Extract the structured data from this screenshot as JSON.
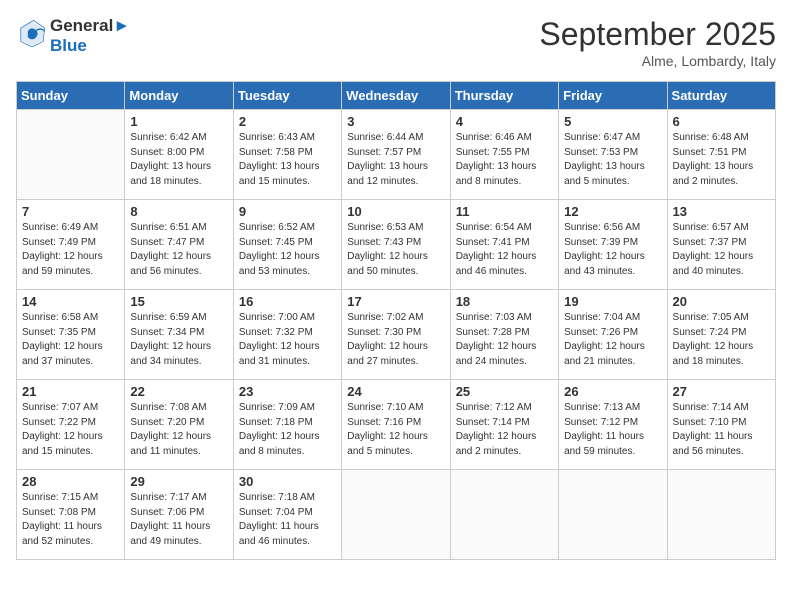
{
  "header": {
    "logo_line1": "General",
    "logo_line2": "Blue",
    "month_title": "September 2025",
    "location": "Alme, Lombardy, Italy"
  },
  "days_of_week": [
    "Sunday",
    "Monday",
    "Tuesday",
    "Wednesday",
    "Thursday",
    "Friday",
    "Saturday"
  ],
  "weeks": [
    [
      {
        "day": "",
        "info": ""
      },
      {
        "day": "1",
        "info": "Sunrise: 6:42 AM\nSunset: 8:00 PM\nDaylight: 13 hours\nand 18 minutes."
      },
      {
        "day": "2",
        "info": "Sunrise: 6:43 AM\nSunset: 7:58 PM\nDaylight: 13 hours\nand 15 minutes."
      },
      {
        "day": "3",
        "info": "Sunrise: 6:44 AM\nSunset: 7:57 PM\nDaylight: 13 hours\nand 12 minutes."
      },
      {
        "day": "4",
        "info": "Sunrise: 6:46 AM\nSunset: 7:55 PM\nDaylight: 13 hours\nand 8 minutes."
      },
      {
        "day": "5",
        "info": "Sunrise: 6:47 AM\nSunset: 7:53 PM\nDaylight: 13 hours\nand 5 minutes."
      },
      {
        "day": "6",
        "info": "Sunrise: 6:48 AM\nSunset: 7:51 PM\nDaylight: 13 hours\nand 2 minutes."
      }
    ],
    [
      {
        "day": "7",
        "info": "Sunrise: 6:49 AM\nSunset: 7:49 PM\nDaylight: 12 hours\nand 59 minutes."
      },
      {
        "day": "8",
        "info": "Sunrise: 6:51 AM\nSunset: 7:47 PM\nDaylight: 12 hours\nand 56 minutes."
      },
      {
        "day": "9",
        "info": "Sunrise: 6:52 AM\nSunset: 7:45 PM\nDaylight: 12 hours\nand 53 minutes."
      },
      {
        "day": "10",
        "info": "Sunrise: 6:53 AM\nSunset: 7:43 PM\nDaylight: 12 hours\nand 50 minutes."
      },
      {
        "day": "11",
        "info": "Sunrise: 6:54 AM\nSunset: 7:41 PM\nDaylight: 12 hours\nand 46 minutes."
      },
      {
        "day": "12",
        "info": "Sunrise: 6:56 AM\nSunset: 7:39 PM\nDaylight: 12 hours\nand 43 minutes."
      },
      {
        "day": "13",
        "info": "Sunrise: 6:57 AM\nSunset: 7:37 PM\nDaylight: 12 hours\nand 40 minutes."
      }
    ],
    [
      {
        "day": "14",
        "info": "Sunrise: 6:58 AM\nSunset: 7:35 PM\nDaylight: 12 hours\nand 37 minutes."
      },
      {
        "day": "15",
        "info": "Sunrise: 6:59 AM\nSunset: 7:34 PM\nDaylight: 12 hours\nand 34 minutes."
      },
      {
        "day": "16",
        "info": "Sunrise: 7:00 AM\nSunset: 7:32 PM\nDaylight: 12 hours\nand 31 minutes."
      },
      {
        "day": "17",
        "info": "Sunrise: 7:02 AM\nSunset: 7:30 PM\nDaylight: 12 hours\nand 27 minutes."
      },
      {
        "day": "18",
        "info": "Sunrise: 7:03 AM\nSunset: 7:28 PM\nDaylight: 12 hours\nand 24 minutes."
      },
      {
        "day": "19",
        "info": "Sunrise: 7:04 AM\nSunset: 7:26 PM\nDaylight: 12 hours\nand 21 minutes."
      },
      {
        "day": "20",
        "info": "Sunrise: 7:05 AM\nSunset: 7:24 PM\nDaylight: 12 hours\nand 18 minutes."
      }
    ],
    [
      {
        "day": "21",
        "info": "Sunrise: 7:07 AM\nSunset: 7:22 PM\nDaylight: 12 hours\nand 15 minutes."
      },
      {
        "day": "22",
        "info": "Sunrise: 7:08 AM\nSunset: 7:20 PM\nDaylight: 12 hours\nand 11 minutes."
      },
      {
        "day": "23",
        "info": "Sunrise: 7:09 AM\nSunset: 7:18 PM\nDaylight: 12 hours\nand 8 minutes."
      },
      {
        "day": "24",
        "info": "Sunrise: 7:10 AM\nSunset: 7:16 PM\nDaylight: 12 hours\nand 5 minutes."
      },
      {
        "day": "25",
        "info": "Sunrise: 7:12 AM\nSunset: 7:14 PM\nDaylight: 12 hours\nand 2 minutes."
      },
      {
        "day": "26",
        "info": "Sunrise: 7:13 AM\nSunset: 7:12 PM\nDaylight: 11 hours\nand 59 minutes."
      },
      {
        "day": "27",
        "info": "Sunrise: 7:14 AM\nSunset: 7:10 PM\nDaylight: 11 hours\nand 56 minutes."
      }
    ],
    [
      {
        "day": "28",
        "info": "Sunrise: 7:15 AM\nSunset: 7:08 PM\nDaylight: 11 hours\nand 52 minutes."
      },
      {
        "day": "29",
        "info": "Sunrise: 7:17 AM\nSunset: 7:06 PM\nDaylight: 11 hours\nand 49 minutes."
      },
      {
        "day": "30",
        "info": "Sunrise: 7:18 AM\nSunset: 7:04 PM\nDaylight: 11 hours\nand 46 minutes."
      },
      {
        "day": "",
        "info": ""
      },
      {
        "day": "",
        "info": ""
      },
      {
        "day": "",
        "info": ""
      },
      {
        "day": "",
        "info": ""
      }
    ]
  ]
}
